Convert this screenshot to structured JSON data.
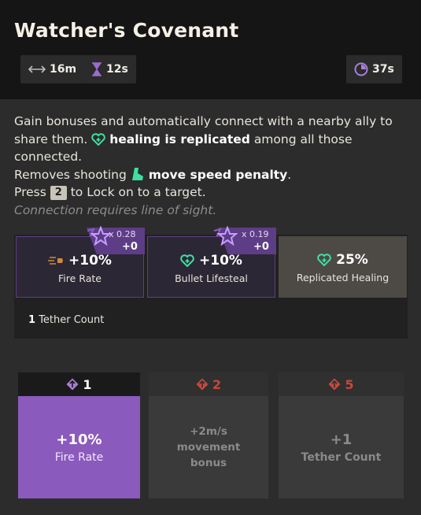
{
  "ability": {
    "title": "Watcher's Covenant",
    "range": "16m",
    "duration": "12s",
    "cooldown": "37s"
  },
  "description": {
    "line1_a": "Gain bonuses and automatically connect with a nearby ally to share them.",
    "line1_bold": "healing is replicated",
    "line1_b": "among all those connected.",
    "line2_a": "Removes shooting",
    "line2_bold": "move speed penalty",
    "line2_b": ".",
    "line3_a": "Press",
    "line3_key": "2",
    "line3_b": "to Lock on to a target.",
    "note": "Connection requires line of sight."
  },
  "stats": [
    {
      "value": "+10%",
      "label": "Fire Rate",
      "multiplier": "x 0.28",
      "bonus": "+0",
      "icon": "fire-rate-icon"
    },
    {
      "value": "+10%",
      "label": "Bullet Lifesteal",
      "multiplier": "x 0.19",
      "bonus": "+0",
      "icon": "heart-plus-icon"
    },
    {
      "value": "25%",
      "label": "Replicated Healing",
      "icon": "heart-plus-icon"
    }
  ],
  "tether": {
    "count": "1",
    "label": "Tether Count"
  },
  "tiers": [
    {
      "cost": "1",
      "line1": "+10%",
      "line2": "Fire Rate",
      "active": true
    },
    {
      "cost": "2",
      "text": "+2m/s movement bonus",
      "active": false
    },
    {
      "cost": "5",
      "line1": "+1",
      "line2": "Tether Count",
      "active": false
    }
  ],
  "colors": {
    "accent_purple": "#8b5abd",
    "spirit_green": "#3de0a0",
    "tier_locked_red": "#c8473b"
  }
}
